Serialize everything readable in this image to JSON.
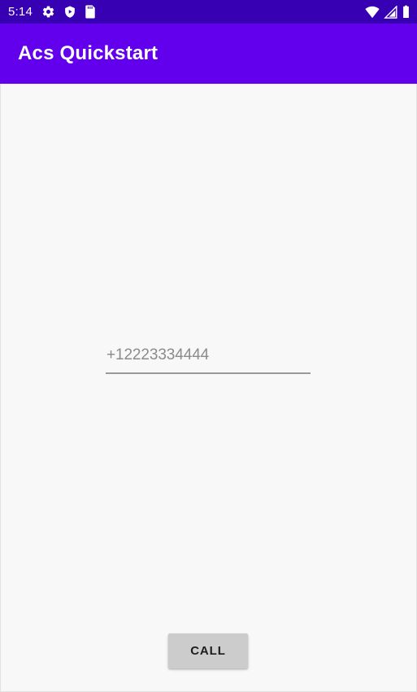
{
  "status_bar": {
    "clock": "5:14",
    "background_color": "#3700B3",
    "left_icons": [
      {
        "name": "settings-gear-icon",
        "label": "Settings"
      },
      {
        "name": "play-protect-shield-icon",
        "label": "Play Protect"
      },
      {
        "name": "sd-card-storage-icon",
        "label": "Storage"
      }
    ],
    "right_icons": [
      {
        "name": "wifi-icon",
        "label": "Wi-Fi"
      },
      {
        "name": "cellular-signal-icon",
        "label": "Cellular signal"
      },
      {
        "name": "battery-icon",
        "label": "Battery"
      }
    ]
  },
  "app_bar": {
    "title": "Acs Quickstart",
    "background_color": "#6200EE",
    "title_color": "#FFFFFF"
  },
  "content": {
    "background_color": "#F8F8F8",
    "phone_field": {
      "value": "+12223334444",
      "placeholder": "+12223334444",
      "text_color": "#8B8B8B",
      "underline_color": "#9A9A9A"
    },
    "call_button": {
      "label": "CALL",
      "background_color": "#CCCCCC",
      "text_color": "#1C1C1C"
    }
  }
}
